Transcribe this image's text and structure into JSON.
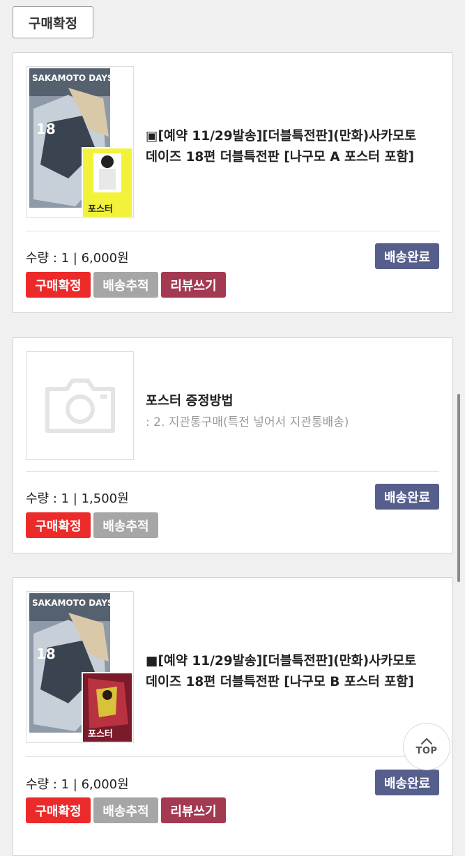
{
  "header": {
    "confirm_button_label": "구매확정"
  },
  "orders": [
    {
      "title_line1": "▣[예약 11/29발송][더블특전판](만화)사카모토",
      "title_line2": "데이즈 18편 더블특전판 [나구모 A 포스터 포함]",
      "cover_title": "SAKAMOTO DAYS",
      "cover_volume": "18",
      "poster_label": "포스터",
      "quantity_text": "수량 : 1 | 6,000원",
      "status": "배송완료",
      "actions": [
        "구매확정",
        "배송추적",
        "리뷰쓰기"
      ]
    },
    {
      "title_line1": "포스터 증정방법",
      "subtitle": ": 2. 지관통구매(특전 넣어서 지관통배송)",
      "quantity_text": "수량 : 1 | 1,500원",
      "status": "배송완료",
      "actions": [
        "구매확정",
        "배송추적"
      ]
    },
    {
      "title_line1": "■[예약 11/29발송][더블특전판](만화)사카모토",
      "title_line2": "데이즈 18편 더블특전판 [나구모 B 포스터 포함]",
      "cover_title": "SAKAMOTO DAYS",
      "cover_volume": "18",
      "poster_label": "포스터",
      "quantity_text": "수량 : 1 | 6,000원",
      "status": "배송완료",
      "actions": [
        "구매확정",
        "배송추적",
        "리뷰쓰기"
      ]
    }
  ],
  "scroll_top": {
    "label": "TOP"
  },
  "colors": {
    "status_badge": "#565f8c",
    "confirm": "#ec2a2a",
    "tracking": "#a6a6a6",
    "review": "#a43a52"
  },
  "icons": [
    "camera-placeholder-icon",
    "chevron-up-icon"
  ]
}
